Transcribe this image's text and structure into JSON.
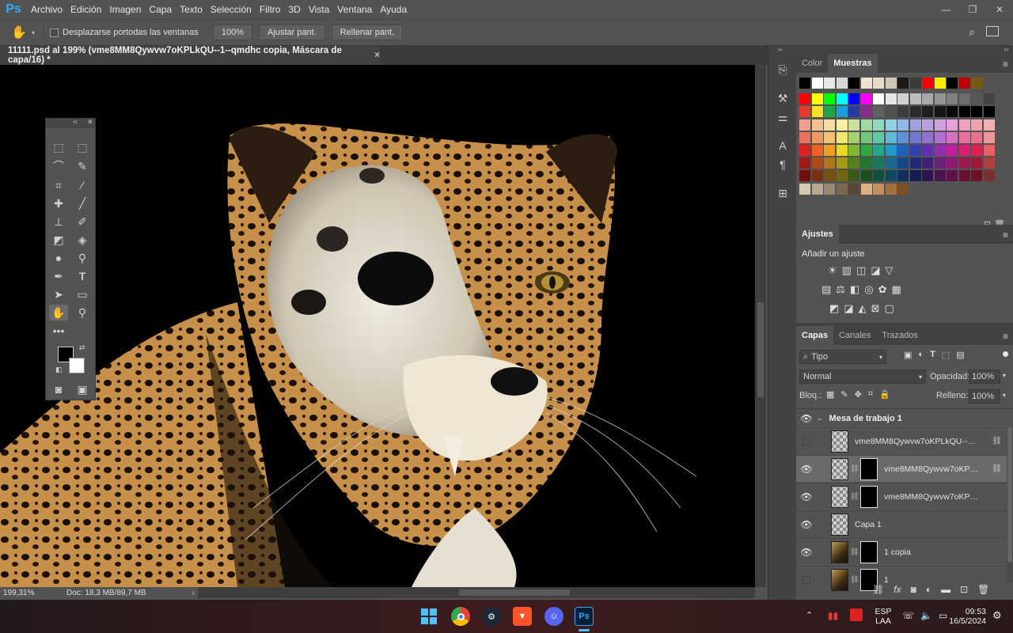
{
  "menubar": {
    "logo": "Ps",
    "items": [
      "Archivo",
      "Edición",
      "Imagen",
      "Capa",
      "Texto",
      "Selección",
      "Filtro",
      "3D",
      "Vista",
      "Ventana",
      "Ayuda"
    ]
  },
  "options": {
    "scroll_all_label": "Desplazarse portodas las ventanas",
    "zoom_btn": "100%",
    "fit_btn": "Ajustar pant.",
    "fill_btn": "Rellenar pant."
  },
  "document": {
    "tab_title": "11111.psd al 199% (vme8MM8Qywvw7oKPLkQU--1--qmdhc copia, Máscara de capa/16) *",
    "close": "×"
  },
  "status": {
    "zoom": "199,31%",
    "doc_info": "Doc: 18,3 MB/89,7 MB"
  },
  "color_panel": {
    "tabs": [
      "Color",
      "Muestras"
    ],
    "active_tab": "Muestras"
  },
  "adjust_panel": {
    "tab": "Ajustes",
    "subtitle": "Añadir un ajuste"
  },
  "layers_panel": {
    "tabs": [
      "Capas",
      "Canales",
      "Trazados"
    ],
    "filter_label": "Tipo",
    "blend_mode": "Normal",
    "opacity_label": "Opacidad:",
    "opacity_value": "100%",
    "lock_label": "Bloq.:",
    "fill_label": "Relleno:",
    "fill_value": "100%",
    "group_name": "Mesa de trabajo 1",
    "layers": [
      {
        "name": "vme8MM8Qywvw7oKPLkQU--1--...",
        "visible": false,
        "thumb": "checker",
        "mask": false,
        "linked": true
      },
      {
        "name": "vme8MM8Qywvw7oKPLk...",
        "visible": true,
        "thumb": "checker",
        "mask": true,
        "linked": true,
        "selected": true
      },
      {
        "name": "vme8MM8Qywvw7oKPLkQU...",
        "visible": true,
        "thumb": "checker",
        "mask": true,
        "linked": false
      },
      {
        "name": "Capa 1",
        "visible": true,
        "thumb": "checker",
        "mask": false,
        "linked": false
      },
      {
        "name": "1 copia",
        "visible": true,
        "thumb": "photo",
        "mask": true,
        "linked": false
      },
      {
        "name": "1",
        "visible": false,
        "thumb": "photo",
        "mask": true,
        "linked": false
      }
    ]
  },
  "taskbar": {
    "lang_top": "ESP",
    "lang_bottom": "LAA",
    "time": "09:53",
    "date": "16/5/2024",
    "ps_label": "Ps"
  },
  "colors": {
    "accent": "#31a8ff",
    "panel_bg": "#535353",
    "dark_bg": "#424242"
  }
}
